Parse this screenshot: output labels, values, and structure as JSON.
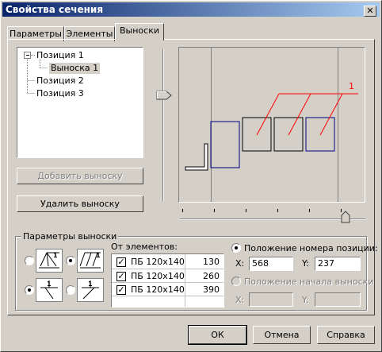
{
  "window": {
    "title": "Свойства сечения",
    "close": "✕"
  },
  "tabs": [
    "Параметры",
    "Элементы",
    "Выноски"
  ],
  "tree": [
    {
      "label": "Позиция 1",
      "expander": "−"
    },
    {
      "label": "Выноска 1"
    },
    {
      "label": "Позиция 2"
    },
    {
      "label": "Позиция 3"
    }
  ],
  "buttons": {
    "add": "Добавить выноску",
    "remove": "Удалить выноску",
    "ok": "ОК",
    "cancel": "Отмена",
    "help": "Справка"
  },
  "preview": {
    "label_number": "1"
  },
  "params": {
    "title": "Параметры выноски",
    "from_elements": "От элементов:",
    "elements": [
      {
        "name": "ПБ 120х140",
        "value": "130",
        "checked": true
      },
      {
        "name": "ПБ 120х140",
        "value": "260",
        "checked": true
      },
      {
        "name": "ПБ 120х140",
        "value": "390",
        "checked": true
      }
    ],
    "pos_number_label": "Положение номера позиции:",
    "x_label": "X:",
    "y_label": "Y:",
    "x_value": "568",
    "y_value": "237",
    "start_pos_label": "Положение начала выноски",
    "x2_label": "X:",
    "y2_label": "Y:",
    "x2_value": "",
    "y2_value": ""
  },
  "colors": {
    "title_start": "#0a246a",
    "title_end": "#a6caf0",
    "leader": "#ff0000",
    "element": "#000080"
  }
}
